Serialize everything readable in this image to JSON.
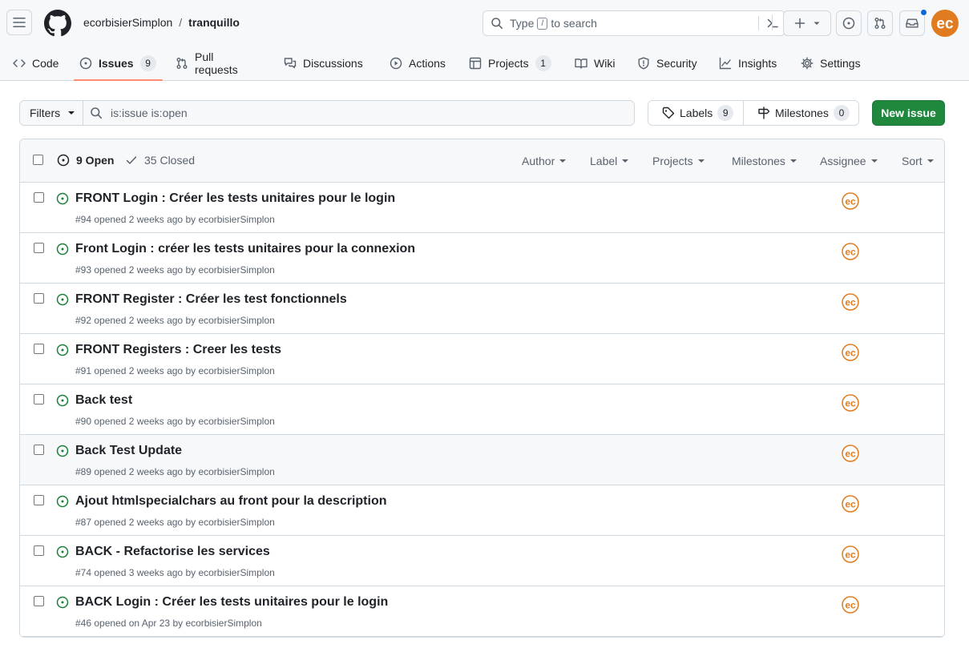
{
  "header": {
    "owner": "ecorbisierSimplon",
    "separator": "/",
    "repo": "tranquillo",
    "search_prefix": "Type",
    "search_key": "/",
    "search_suffix": "to search"
  },
  "nav": {
    "code": "Code",
    "issues": "Issues",
    "issues_count": "9",
    "pulls": "Pull requests",
    "discussions": "Discussions",
    "actions": "Actions",
    "projects": "Projects",
    "projects_count": "1",
    "wiki": "Wiki",
    "security": "Security",
    "insights": "Insights",
    "settings": "Settings"
  },
  "subnav": {
    "filters": "Filters",
    "query": "is:issue is:open",
    "labels": "Labels",
    "labels_count": "9",
    "milestones": "Milestones",
    "milestones_count": "0",
    "new_issue": "New issue"
  },
  "list_header": {
    "open": "9 Open",
    "closed": "35 Closed",
    "author": "Author",
    "label": "Label",
    "projects": "Projects",
    "milestones": "Milestones",
    "assignee": "Assignee",
    "sort": "Sort"
  },
  "issues": [
    {
      "title": "FRONT Login : Créer les tests unitaires pour le login",
      "meta": "#94 opened 2 weeks ago by ecorbisierSimplon"
    },
    {
      "title": "Front Login : créer les tests unitaires pour la connexion",
      "meta": "#93 opened 2 weeks ago by ecorbisierSimplon"
    },
    {
      "title": "FRONT Register : Créer les test fonctionnels",
      "meta": "#92 opened 2 weeks ago by ecorbisierSimplon"
    },
    {
      "title": "FRONT Registers : Creer les tests",
      "meta": "#91 opened 2 weeks ago by ecorbisierSimplon"
    },
    {
      "title": "Back test",
      "meta": "#90 opened 2 weeks ago by ecorbisierSimplon"
    },
    {
      "title": "Back Test Update",
      "meta": "#89 opened 2 weeks ago by ecorbisierSimplon"
    },
    {
      "title": "Ajout htmlspecialchars au front pour la description",
      "meta": "#87 opened 2 weeks ago by ecorbisierSimplon"
    },
    {
      "title": "BACK - Refactorise les services",
      "meta": "#74 opened 3 weeks ago by ecorbisierSimplon"
    },
    {
      "title": "BACK Login : Créer les tests unitaires pour le login",
      "meta": "#46 opened on Apr 23 by ecorbisierSimplon"
    }
  ],
  "colors": {
    "accent_green": "#1f883d",
    "open_icon": "#1a7f37",
    "tab_underline": "#fd8c73",
    "avatar_orange": "#e07b1f",
    "notification_blue": "#0969da"
  }
}
